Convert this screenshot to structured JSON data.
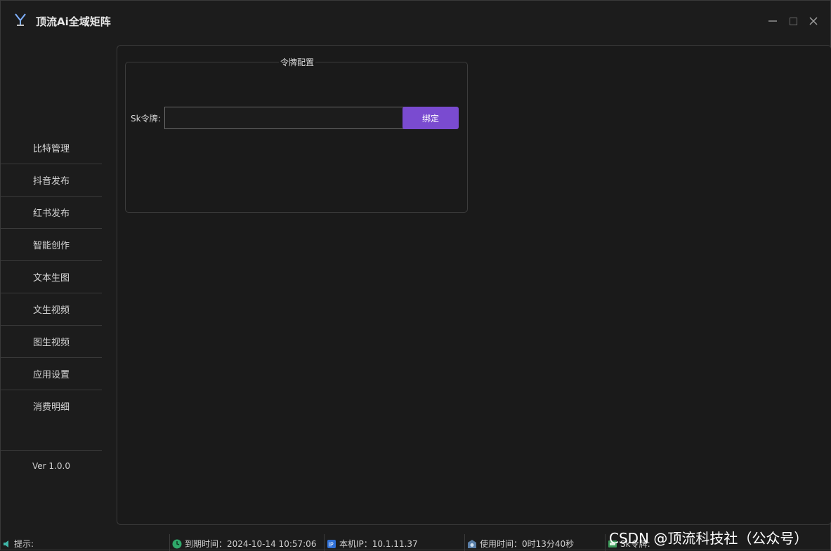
{
  "app": {
    "title": "顶流Ai全域矩阵"
  },
  "window_controls": {
    "minimize": "—",
    "maximize": "□",
    "close": "✕"
  },
  "sidebar": {
    "items": [
      {
        "label": "比特管理"
      },
      {
        "label": "抖音发布"
      },
      {
        "label": "红书发布"
      },
      {
        "label": "智能创作"
      },
      {
        "label": "文本生图"
      },
      {
        "label": "文生视频"
      },
      {
        "label": "图生视频"
      },
      {
        "label": "应用设置"
      },
      {
        "label": "消费明细"
      }
    ],
    "version": "Ver 1.0.0"
  },
  "token_config": {
    "title": "令牌配置",
    "label": "Sk令牌:",
    "input_value": "",
    "bind_button": "绑定"
  },
  "statusbar": {
    "tip": "提示:",
    "expire": "到期时间：2024-10-14 10:57:06",
    "ip": "本机IP：10.1.11.37",
    "usage": "使用时间：0时13分40秒",
    "sk": "Sk令牌:"
  },
  "watermark": "CSDN @顶流科技社（公众号）",
  "colors": {
    "accent": "#7a4bd0",
    "background": "#1c1c1c",
    "border": "#3a3a3a"
  },
  "icons": [
    "app-logo-icon",
    "speaker-icon",
    "clock-icon",
    "ip-icon",
    "timer-icon",
    "key-icon"
  ]
}
